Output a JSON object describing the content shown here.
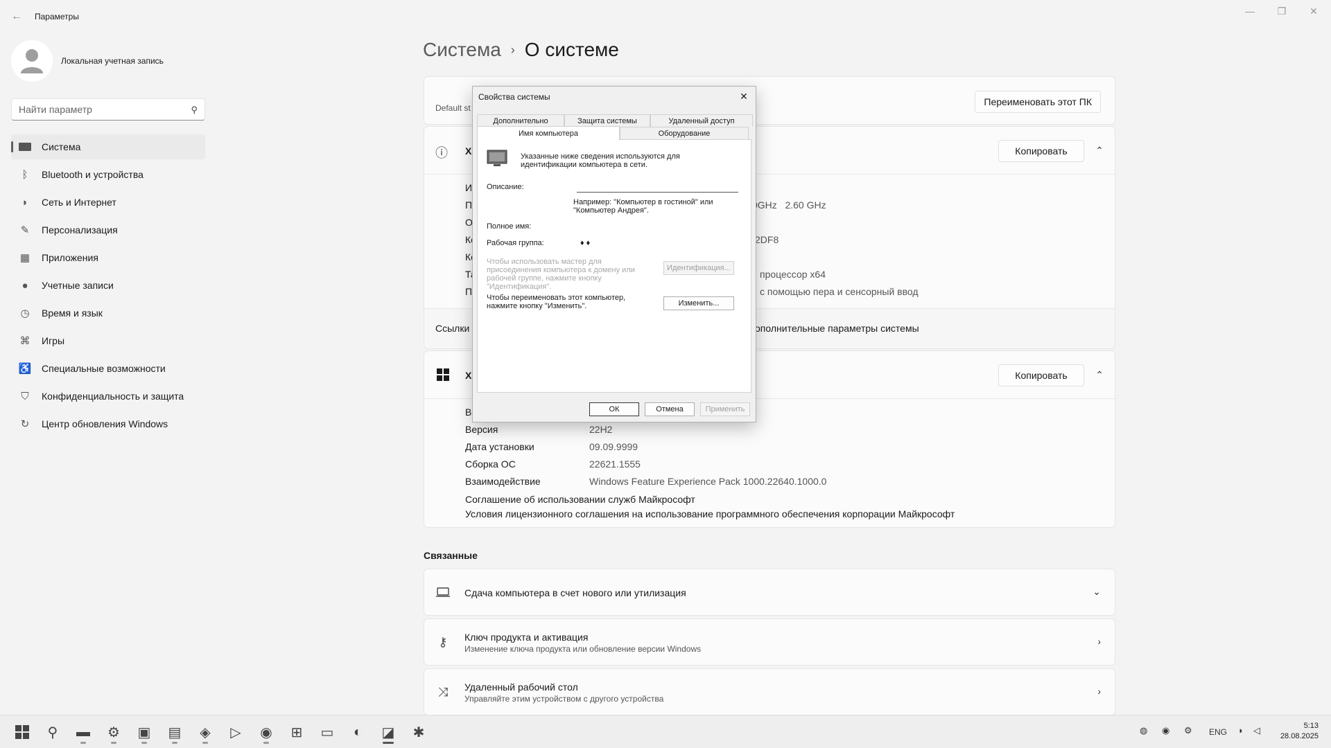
{
  "window": {
    "title": "Параметры"
  },
  "sidebar": {
    "profile_name": "Локальная учетная запись",
    "search_placeholder": "Найти параметр",
    "items": [
      {
        "label": "Система",
        "icon": "monitor-icon"
      },
      {
        "label": "Bluetooth и устройства",
        "icon": "bluetooth-icon"
      },
      {
        "label": "Сеть и Интернет",
        "icon": "wifi-icon"
      },
      {
        "label": "Персонализация",
        "icon": "brush-icon"
      },
      {
        "label": "Приложения",
        "icon": "apps-icon"
      },
      {
        "label": "Учетные записи",
        "icon": "person-icon"
      },
      {
        "label": "Время и язык",
        "icon": "clock-globe-icon"
      },
      {
        "label": "Игры",
        "icon": "gamepad-icon"
      },
      {
        "label": "Специальные возможности",
        "icon": "accessibility-icon"
      },
      {
        "label": "Конфиденциальность и защита",
        "icon": "shield-icon"
      },
      {
        "label": "Центр обновления Windows",
        "icon": "update-icon"
      }
    ]
  },
  "main": {
    "breadcrumb_parent": "Система",
    "breadcrumb_separator": "›",
    "breadcrumb_current": "О системе",
    "top_card": {
      "partial_text": "Default st",
      "rename_button": "Переименовать этот ПК"
    },
    "device_card": {
      "title_partial": "Ха",
      "copy_button": "Копировать",
      "row_labels_partial": [
        "И",
        "П",
        "О",
        "Ко",
        "Ко",
        "Та",
        "П"
      ],
      "cpu_value_partial": "0GHz   2.60 GHz",
      "product_id_partial": "2DF8",
      "system_type_partial": "процессор x64",
      "pen_touch_partial": "с помощью пера и сенсорный ввод"
    },
    "links_row": {
      "label": "Ссылки",
      "advanced_partial": "ополнительные параметры системы"
    },
    "windows_card": {
      "title_partial": "Ха",
      "copy_button": "Копировать",
      "edition_label_partial": "В",
      "rows": [
        {
          "label": "Версия",
          "value": "22H2"
        },
        {
          "label": "Дата установки",
          "value": "09.09.9999"
        },
        {
          "label": "Сборка ОС",
          "value": "22621.1555"
        },
        {
          "label": "Взаимодействие",
          "value": "Windows Feature Experience Pack 1000.22640.1000.0"
        }
      ],
      "link1": "Соглашение об использовании служб Майкрософт",
      "link2": "Условия лицензионного соглашения на использование программного обеспечения корпорации Майкрософт"
    },
    "related": {
      "title": "Связанные",
      "items": [
        {
          "title": "Сдача компьютера в счет нового или утилизация",
          "subtitle": ""
        },
        {
          "title": "Ключ продукта и активация",
          "subtitle": "Изменение ключа продукта или обновление версии Windows"
        },
        {
          "title": "Удаленный рабочий стол",
          "subtitle": "Управляйте этим устройством с другого устройства"
        }
      ]
    }
  },
  "dialog": {
    "title": "Свойства системы",
    "tabs_back": [
      "Дополнительно",
      "Защита системы",
      "Удаленный доступ"
    ],
    "tabs_front": [
      "Имя компьютера",
      "Оборудование"
    ],
    "intro_line1": "Указанные ниже сведения используются для",
    "intro_line2": "идентификации компьютера в сети.",
    "description_label": "Описание:",
    "description_value": "",
    "example_line1": "Например: \"Компьютер в гостиной\" или",
    "example_line2": "\"Компьютер Андрея\".",
    "fullname_label": "Полное имя:",
    "workgroup_label": "Рабочая группа:",
    "workgroup_value": "♦ ♦",
    "wizard_line1": "Чтобы использовать мастер для",
    "wizard_line2": "присоединения компьютера к домену или",
    "wizard_line3": "рабочей группе, нажмите кнопку",
    "wizard_line4": "\"Идентификация\".",
    "identify_button": "Идентификация...",
    "rename_line1": "Чтобы переименовать этот компьютер,",
    "rename_line2": "нажмите кнопку \"Изменить\".",
    "change_button": "Изменить...",
    "ok_button": "ОК",
    "cancel_button": "Отмена",
    "apply_button": "Применить"
  },
  "taskbar": {
    "tray_lang": "ENG",
    "time": "5:13",
    "date": "28.08.2025"
  }
}
